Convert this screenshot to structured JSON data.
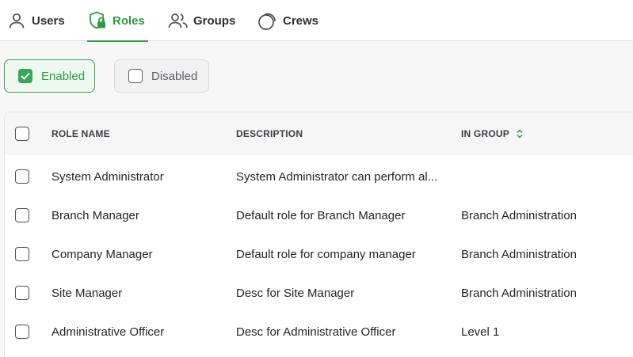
{
  "tabs": [
    {
      "label": "Users",
      "icon": "user-icon",
      "active": false
    },
    {
      "label": "Roles",
      "icon": "shield-lock-icon",
      "active": true
    },
    {
      "label": "Groups",
      "icon": "users-icon",
      "active": false
    },
    {
      "label": "Crews",
      "icon": "circles-icon",
      "active": false
    }
  ],
  "filters": {
    "enabled_label": "Enabled",
    "disabled_label": "Disabled"
  },
  "table": {
    "headers": {
      "name": "ROLE NAME",
      "description": "DESCRIPTION",
      "group": "IN GROUP"
    },
    "rows": [
      {
        "name": "System Administrator",
        "description": "System Administrator can perform al...",
        "group": ""
      },
      {
        "name": "Branch Manager",
        "description": "Default role for Branch Manager",
        "group": "Branch Administration"
      },
      {
        "name": "Company Manager",
        "description": "Default role for company manager",
        "group": "Branch Administration"
      },
      {
        "name": "Site Manager",
        "description": "Desc for Site Manager",
        "group": "Branch Administration"
      },
      {
        "name": "Administrative Officer",
        "description": "Desc for Administrative Officer",
        "group": "Level 1"
      }
    ]
  },
  "colors": {
    "accent": "#2e9a43",
    "accent_fill": "#34a853",
    "chip_enabled_bg": "#eef8ef"
  }
}
